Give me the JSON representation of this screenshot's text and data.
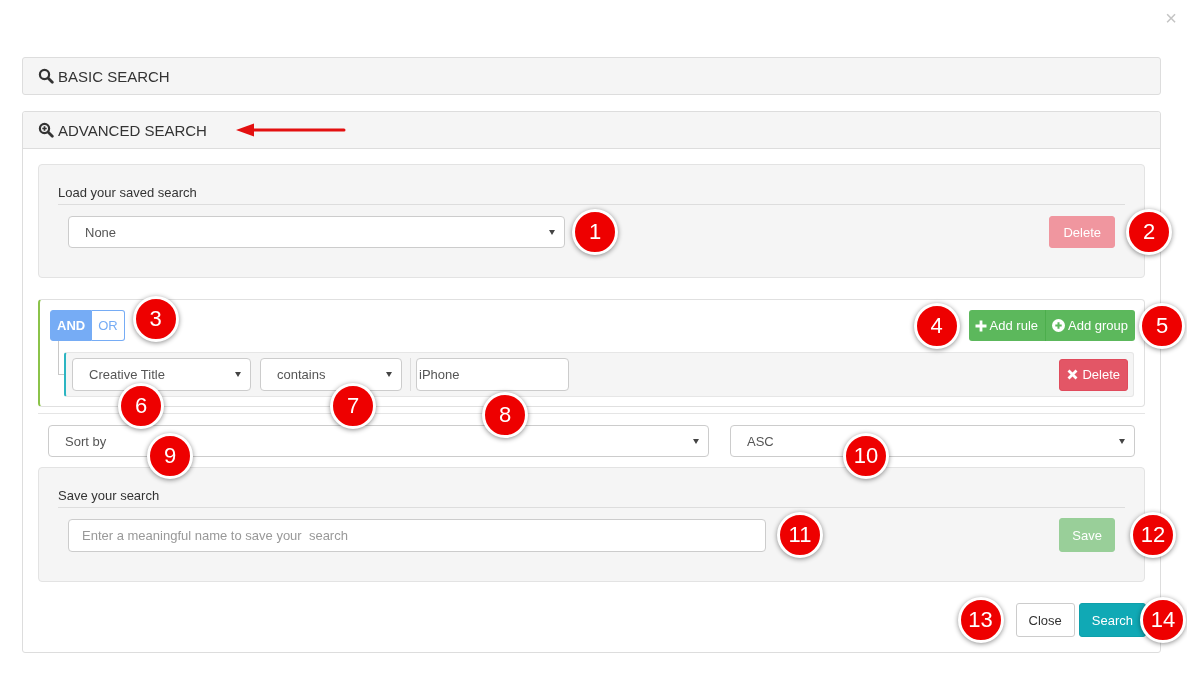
{
  "close_button": {
    "label": "×"
  },
  "basic_search": {
    "title": "BASIC SEARCH"
  },
  "advanced_search": {
    "title": "ADVANCED SEARCH",
    "saved_search": {
      "label": "Load your saved search",
      "select": {
        "value": "None",
        "callout": "1"
      },
      "delete_button": {
        "label": "Delete",
        "kind": "danger",
        "disabled": true,
        "callout": "2"
      }
    },
    "query_builder": {
      "conditions": [
        {
          "label": "AND",
          "selected": true
        },
        {
          "label": "OR",
          "selected": false
        }
      ],
      "conditions_callout": "3",
      "actions": [
        {
          "label": "Add rule",
          "kind": "rule",
          "callout": "4"
        },
        {
          "label": "Add group",
          "kind": "group",
          "callout": "5"
        }
      ],
      "rules": [
        {
          "field": {
            "value": "Creative Title",
            "callout": "6"
          },
          "operator": {
            "value": "contains",
            "callout": "7"
          },
          "input": {
            "value": "iPhone",
            "callout": "8"
          },
          "delete_button": {
            "label": "Delete",
            "kind": "danger",
            "disabled": false
          }
        }
      ]
    },
    "sort": {
      "field": {
        "value": "Sort by",
        "callout": "9"
      },
      "order": {
        "value": "ASC",
        "callout": "10"
      }
    },
    "save_search": {
      "label": "Save your search",
      "input": {
        "placeholder": "Enter a meaningful name to save your  search",
        "callout": "11"
      },
      "save_button": {
        "label": "Save",
        "kind": "success",
        "disabled": true,
        "callout": "12"
      }
    },
    "footer_buttons": [
      {
        "label": "Close",
        "kind": "default",
        "disabled": false,
        "callout": "13"
      },
      {
        "label": "Search",
        "kind": "info",
        "disabled": false,
        "callout": "14"
      }
    ]
  }
}
